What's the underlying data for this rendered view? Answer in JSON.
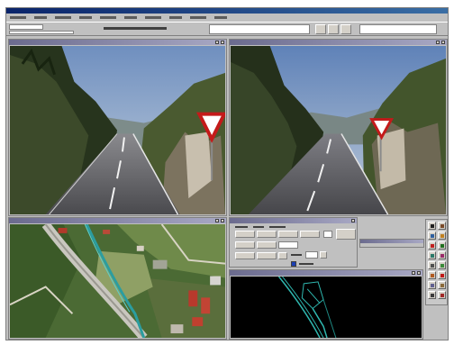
{
  "window": {
    "title": "",
    "menu": [
      "",
      "",
      "",
      "",
      "",
      "",
      "",
      "",
      "",
      ""
    ],
    "status_field": "",
    "coordinates": ""
  },
  "panes": {
    "left_camera": {
      "title": ""
    },
    "right_camera": {
      "title": ""
    },
    "aerial_map": {
      "title": ""
    },
    "control_panel": {
      "title": "",
      "tabs": [
        "",
        "",
        ""
      ],
      "checkbox_label": "",
      "value_field": ""
    },
    "vector_view": {
      "title": ""
    }
  },
  "colors": {
    "window_chrome": "#c0c0c0",
    "titlebar": "#0a246a",
    "sky": "#6a8fc4",
    "road": "#5a5a5e",
    "vegetation": "#3f5a2a",
    "vector_lines": "#2fb8b0",
    "vector_background": "#000000"
  },
  "icons": {
    "yield_sign": "yield-sign-icon",
    "tools": [
      "arrow-icon",
      "pan-icon",
      "zoom-icon",
      "ruler-icon",
      "point-icon",
      "line-icon",
      "polygon-icon",
      "erase-icon",
      "rotate-icon",
      "layer-icon",
      "color-icon",
      "close-icon"
    ]
  }
}
